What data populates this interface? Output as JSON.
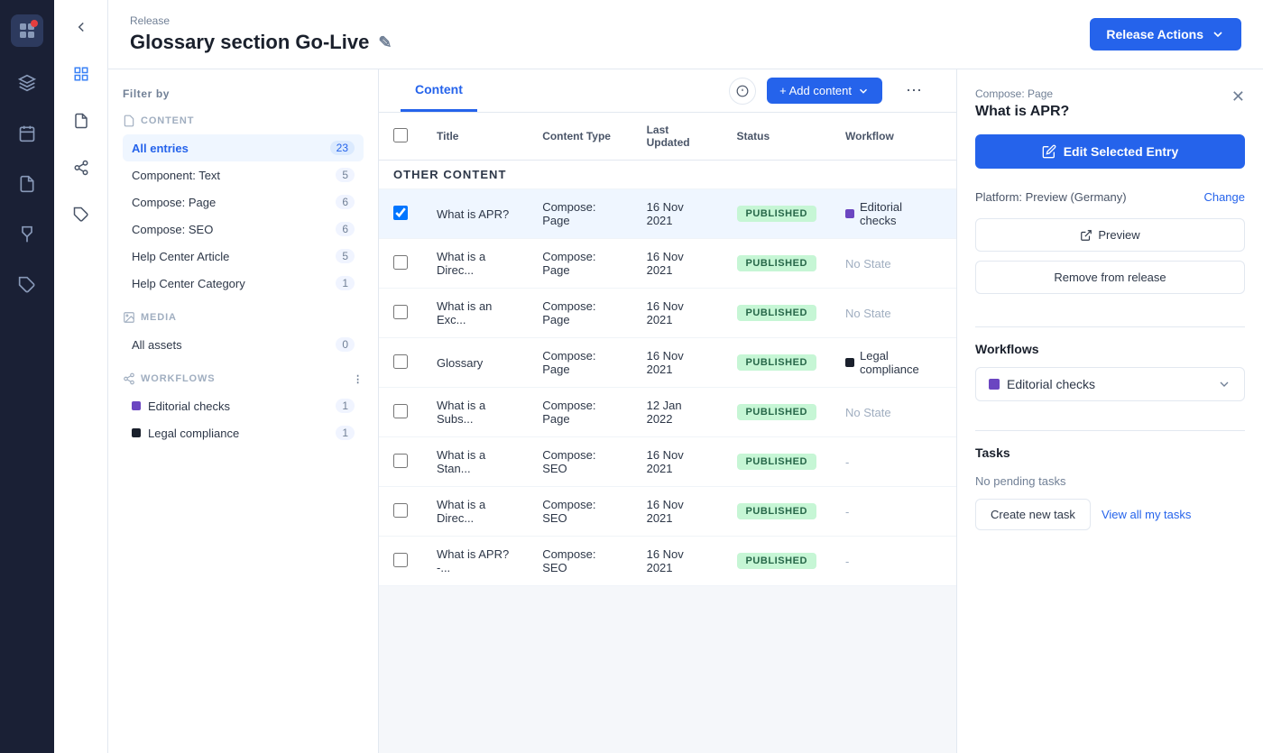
{
  "app": {
    "logo_dot_color": "#e53e3e"
  },
  "header": {
    "release_label": "Release",
    "title": "Glossary section Go-Live",
    "release_actions_btn": "Release Actions"
  },
  "tabs": {
    "items": [
      {
        "label": "Content",
        "active": true
      }
    ]
  },
  "tab_actions": {
    "add_content": "+ Add content",
    "more": "..."
  },
  "filter": {
    "title": "Filter by",
    "content_section": "CONTENT",
    "media_section": "MEDIA",
    "workflows_section": "WORKFLOWS",
    "items": [
      {
        "name": "All entries",
        "count": 23,
        "active": true
      },
      {
        "name": "Component: Text",
        "count": 5,
        "active": false
      },
      {
        "name": "Compose: Page",
        "count": 6,
        "active": false
      },
      {
        "name": "Compose: SEO",
        "count": 6,
        "active": false
      },
      {
        "name": "Help Center Article",
        "count": 5,
        "active": false
      },
      {
        "name": "Help Center Category",
        "count": 1,
        "active": false
      }
    ],
    "media_items": [
      {
        "name": "All assets",
        "count": 0,
        "active": false
      }
    ],
    "workflow_items": [
      {
        "name": "Editorial checks",
        "count": 1,
        "dot": "purple"
      },
      {
        "name": "Legal compliance",
        "count": 1,
        "dot": "dark"
      }
    ]
  },
  "table": {
    "columns": [
      "Title",
      "Content Type",
      "Last Updated",
      "Status",
      "Workflow"
    ],
    "section_label": "OTHER CONTENT",
    "rows": [
      {
        "id": 1,
        "title": "What is APR?",
        "content_type": "Compose: Page",
        "last_updated": "16 Nov 2021",
        "status": "PUBLISHED",
        "workflow": "Editorial checks",
        "workflow_dot": "purple",
        "selected": true
      },
      {
        "id": 2,
        "title": "What is a Direc...",
        "content_type": "Compose: Page",
        "last_updated": "16 Nov 2021",
        "status": "PUBLISHED",
        "workflow": "No State",
        "workflow_dot": null,
        "selected": false
      },
      {
        "id": 3,
        "title": "What is an Exc...",
        "content_type": "Compose: Page",
        "last_updated": "16 Nov 2021",
        "status": "PUBLISHED",
        "workflow": "No State",
        "workflow_dot": null,
        "selected": false
      },
      {
        "id": 4,
        "title": "Glossary",
        "content_type": "Compose: Page",
        "last_updated": "16 Nov 2021",
        "status": "PUBLISHED",
        "workflow": "Legal compliance",
        "workflow_dot": "dark",
        "selected": false
      },
      {
        "id": 5,
        "title": "What is a Subs...",
        "content_type": "Compose: Page",
        "last_updated": "12 Jan 2022",
        "status": "PUBLISHED",
        "workflow": "No State",
        "workflow_dot": null,
        "selected": false
      },
      {
        "id": 6,
        "title": "What is a Stan...",
        "content_type": "Compose: SEO",
        "last_updated": "16 Nov 2021",
        "status": "PUBLISHED",
        "workflow": "-",
        "workflow_dot": null,
        "selected": false
      },
      {
        "id": 7,
        "title": "What is a Direc...",
        "content_type": "Compose: SEO",
        "last_updated": "16 Nov 2021",
        "status": "PUBLISHED",
        "workflow": "-",
        "workflow_dot": null,
        "selected": false
      },
      {
        "id": 8,
        "title": "What is APR? -...",
        "content_type": "Compose: SEO",
        "last_updated": "16 Nov 2021",
        "status": "PUBLISHED",
        "workflow": "-",
        "workflow_dot": null,
        "selected": false
      }
    ]
  },
  "right_panel": {
    "subtitle": "Compose: Page",
    "title": "What is APR?",
    "edit_btn": "Edit Selected Entry",
    "platform_label": "Platform: Preview (Germany)",
    "change_label": "Change",
    "preview_btn": "Preview",
    "remove_btn": "Remove from release",
    "workflows_title": "Workflows",
    "workflow_selected": "Editorial checks",
    "tasks_title": "Tasks",
    "no_tasks": "No pending tasks",
    "create_task_btn": "Create new task",
    "view_tasks_link": "View all my tasks"
  },
  "icons": {
    "grid": "⊞",
    "calendar": "📅",
    "document": "📄",
    "plug": "🔌",
    "puzzle": "🧩",
    "chevron_down": "▾",
    "pencil": "✎",
    "info": "ℹ",
    "external": "↗",
    "check": "✓"
  }
}
